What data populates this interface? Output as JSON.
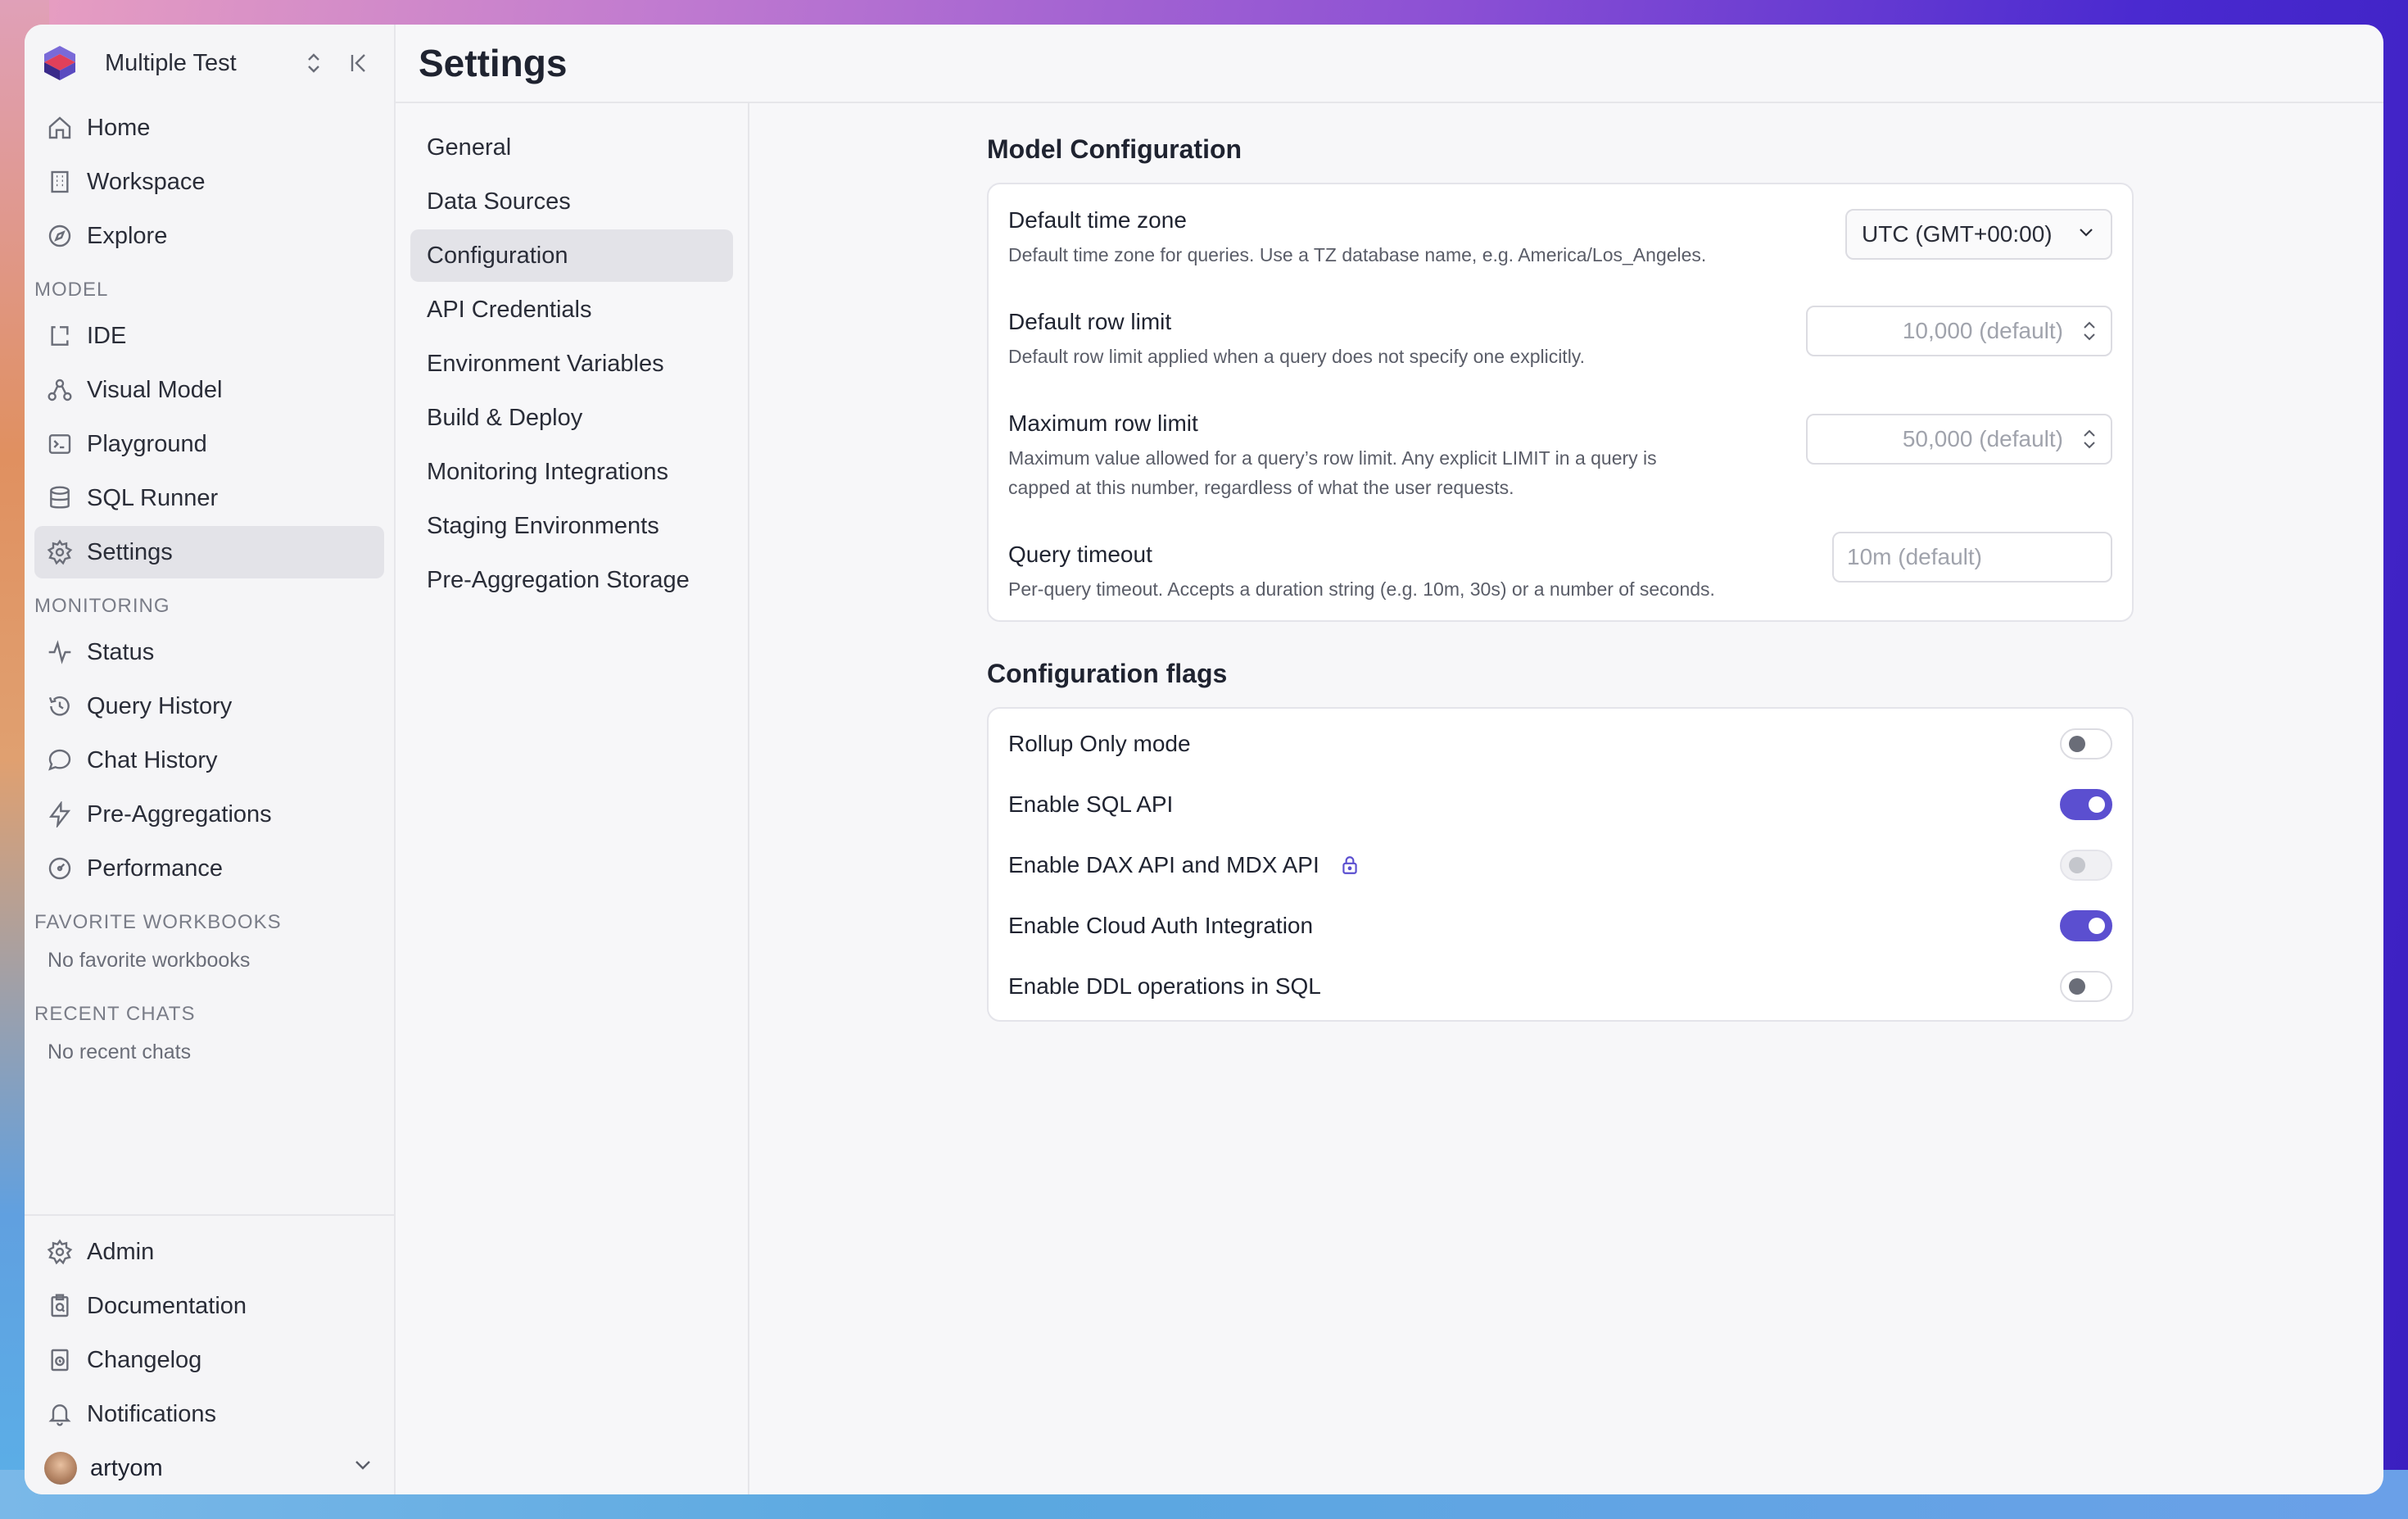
{
  "workspace": {
    "name": "Multiple Test"
  },
  "sidebar": {
    "top_items": [
      {
        "label": "Home",
        "icon": "home-icon"
      },
      {
        "label": "Workspace",
        "icon": "building-icon"
      },
      {
        "label": "Explore",
        "icon": "compass-icon"
      }
    ],
    "model_label": "MODEL",
    "model_items": [
      {
        "label": "IDE",
        "icon": "ide-icon"
      },
      {
        "label": "Visual Model",
        "icon": "diagram-icon"
      },
      {
        "label": "Playground",
        "icon": "terminal-icon"
      },
      {
        "label": "SQL Runner",
        "icon": "database-icon"
      },
      {
        "label": "Settings",
        "icon": "gear-icon",
        "active": true
      }
    ],
    "monitoring_label": "MONITORING",
    "monitoring_items": [
      {
        "label": "Status",
        "icon": "pulse-icon"
      },
      {
        "label": "Query History",
        "icon": "history-icon"
      },
      {
        "label": "Chat History",
        "icon": "chat-icon"
      },
      {
        "label": "Pre-Aggregations",
        "icon": "lightning-icon"
      },
      {
        "label": "Performance",
        "icon": "gauge-icon"
      }
    ],
    "favorites_label": "FAVORITE WORKBOOKS",
    "favorites_empty": "No favorite workbooks",
    "recent_label": "RECENT CHATS",
    "recent_empty": "No recent chats",
    "bottom_items": [
      {
        "label": "Admin",
        "icon": "gear-icon"
      },
      {
        "label": "Documentation",
        "icon": "docs-icon"
      },
      {
        "label": "Changelog",
        "icon": "changelog-icon"
      },
      {
        "label": "Notifications",
        "icon": "bell-icon"
      }
    ],
    "user": {
      "name": "artyom"
    }
  },
  "page": {
    "title": "Settings"
  },
  "subnav": [
    {
      "label": "General"
    },
    {
      "label": "Data Sources"
    },
    {
      "label": "Configuration",
      "active": true
    },
    {
      "label": "API Credentials"
    },
    {
      "label": "Environment Variables"
    },
    {
      "label": "Build & Deploy"
    },
    {
      "label": "Monitoring Integrations"
    },
    {
      "label": "Staging Environments"
    },
    {
      "label": "Pre-Aggregation Storage"
    }
  ],
  "model_config": {
    "title": "Model Configuration",
    "timezone": {
      "label": "Default time zone",
      "desc": "Default time zone for queries. Use a TZ database name, e.g. America/Los_Angeles.",
      "value": "UTC (GMT+00:00)"
    },
    "row_limit": {
      "label": "Default row limit",
      "desc": "Default row limit applied when a query does not specify one explicitly.",
      "placeholder": "10,000 (default)"
    },
    "max_row_limit": {
      "label": "Maximum row limit",
      "desc_line1": "Maximum value allowed for a query’s row limit. Any explicit LIMIT in a query is",
      "desc_line2": "capped at this number, regardless of what the user requests.",
      "placeholder": "50,000 (default)"
    },
    "timeout": {
      "label": "Query timeout",
      "desc": "Per-query timeout. Accepts a duration string (e.g. 10m, 30s) or a number of seconds.",
      "placeholder": "10m (default)"
    }
  },
  "flags": {
    "title": "Configuration flags",
    "items": [
      {
        "label": "Rollup Only mode",
        "state": "off"
      },
      {
        "label": "Enable SQL API",
        "state": "on"
      },
      {
        "label": "Enable DAX API and MDX API",
        "state": "disabled",
        "locked": true
      },
      {
        "label": "Enable Cloud Auth Integration",
        "state": "on"
      },
      {
        "label": "Enable DDL operations in SQL",
        "state": "off"
      }
    ]
  },
  "colors": {
    "accent": "#5b4fd0"
  }
}
